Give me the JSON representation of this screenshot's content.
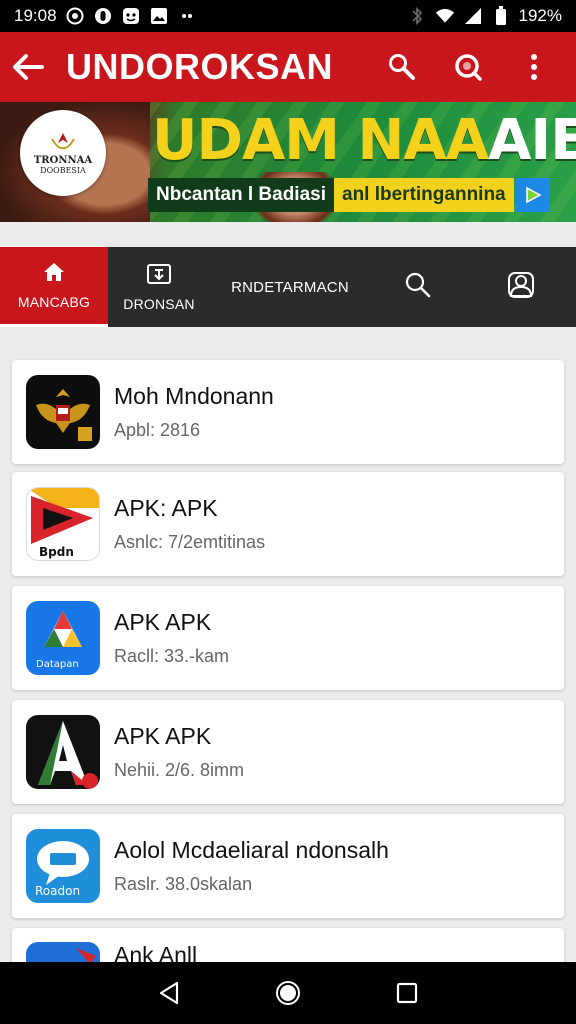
{
  "status_bar": {
    "time": "19:08",
    "battery": "192%",
    "notification_icons": [
      "whatsapp-icon",
      "circle-app-icon",
      "face-icon",
      "image-icon",
      "dots-icon"
    ]
  },
  "app_bar": {
    "title": "UNDOROKSAN",
    "accent_color": "#c8161c"
  },
  "banner": {
    "logo_line1": "TRONNAA",
    "logo_line2": "DOOBESIA",
    "headline_part1": "UDAM NAA",
    "headline_part2": "AIE",
    "sub_dark": "Nbcantan l Badiasi",
    "sub_yellow": "anl lbertingannina"
  },
  "tabs": [
    {
      "label": "MANCABG",
      "icon": "home-icon",
      "active": true
    },
    {
      "label": "DRONSAN",
      "icon": "download-icon",
      "active": false
    },
    {
      "label": "RNDETARMACN",
      "icon": "",
      "active": false
    },
    {
      "label": "",
      "icon": "search-icon",
      "active": false
    },
    {
      "label": "",
      "icon": "account-icon",
      "active": false
    }
  ],
  "apps": [
    {
      "title": "Moh Mndonann",
      "subtitle": "Apbl: 2816",
      "icon": "garuda-icon"
    },
    {
      "title": "APK: APK",
      "subtitle": "Asnlc: 7/2emtitinas",
      "icon": "play-logo-icon"
    },
    {
      "title": "APK APK",
      "subtitle": "Racll: 33.-kam",
      "icon": "blue-app-icon"
    },
    {
      "title": "APK APK",
      "subtitle": "Nehii. 2/6. 8imm",
      "icon": "letter-a-icon"
    },
    {
      "title": "Aolol Mcdaeliaral ndonsalh",
      "subtitle": "Raslr. 38.0skalan",
      "icon": "chat-bubble-icon"
    },
    {
      "title": "Ank Anll",
      "subtitle": "",
      "icon": "partial-app-icon"
    }
  ]
}
